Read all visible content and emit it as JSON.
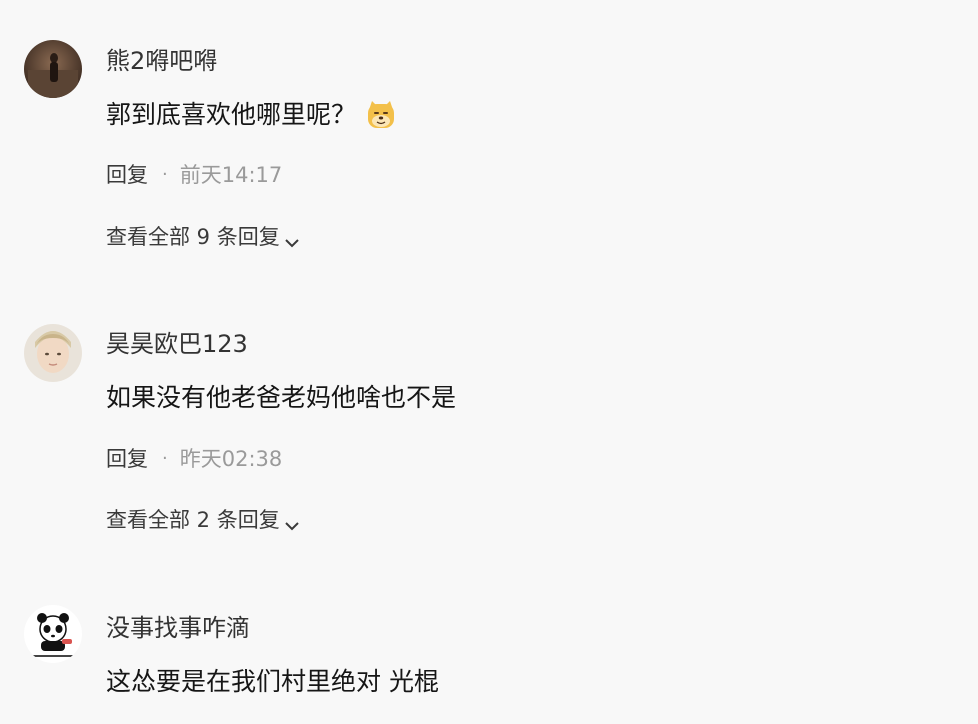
{
  "comments": [
    {
      "username": "熊2嘚吧嘚",
      "text": "郭到底喜欢他哪里呢？",
      "emoji": "doge-emoji",
      "reply_label": "回复",
      "separator": "·",
      "time": "前天14:17",
      "view_all": "查看全部 9 条回复"
    },
    {
      "username": "昊昊欧巴123",
      "text": "如果没有他老爸老妈他啥也不是",
      "reply_label": "回复",
      "separator": "·",
      "time": "昨天02:38",
      "view_all": "查看全部 2 条回复"
    },
    {
      "username": "没事找事咋滴",
      "text": "这怂要是在我们村里绝对 光棍"
    }
  ],
  "icons": {
    "expand": "chevron-down-icon"
  },
  "colors": {
    "background": "#f8f8f8",
    "text": "#161616",
    "muted": "#9a9a9a"
  }
}
